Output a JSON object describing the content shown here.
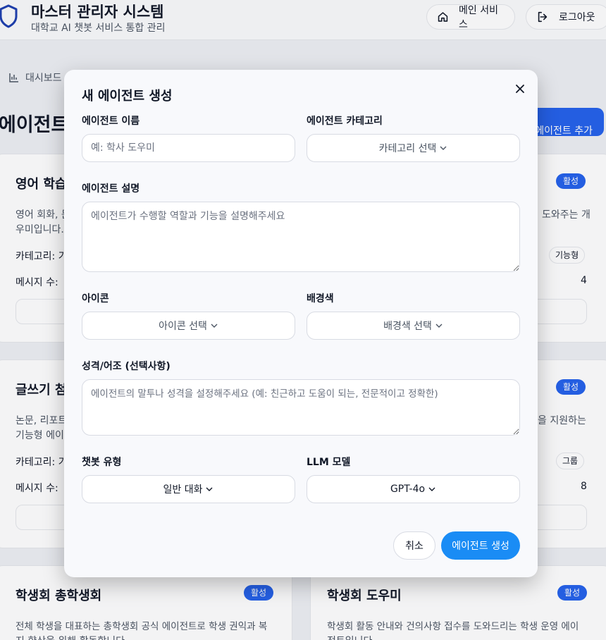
{
  "header": {
    "title": "마스터 관리자 시스템",
    "subtitle": "대학교 AI 챗봇 서비스 통합 관리",
    "home_label": "메인 서비스",
    "logout_label": "로그아웃"
  },
  "breadcrumb": {
    "label": "대시보드"
  },
  "page": {
    "title": "에이전트",
    "add_button": "에이전트 추가"
  },
  "cards": [
    {
      "title": "영어 학습",
      "badge": "활성",
      "desc1": "영어 회화, 문",
      "desc2": "우미입니다.",
      "desc_right": "도와주는 개",
      "category_label": "카테고리: 기",
      "tag": "기능형",
      "msg_label": "메시지 수:",
      "msg_count": "4"
    },
    {
      "title": "글쓰기 첨",
      "badge": "활성",
      "desc1": "논문, 리포트",
      "desc2": "기능형 에이",
      "desc_right": "을 지원하는",
      "category_label": "카테고리: 기",
      "tag": "그룹",
      "msg_label": "메시지 수:",
      "msg_count": "8"
    },
    {
      "title": "학생회 총학생회",
      "badge": "활성",
      "desc1": "전체 학생을 대표하는 총학생회 공식 에이전트로 학생 권익과 복",
      "desc2": "지 향상을 위해 활동합니다."
    },
    {
      "title": "학생회 도우미",
      "badge": "활성",
      "desc1": "학생회 활동 안내와 건의사항 접수를 도와드리는 학생 운영 에이",
      "desc2": "전트입니다."
    }
  ],
  "modal": {
    "title": "새 에이전트 생성",
    "name_label": "에이전트 이름",
    "name_placeholder": "예: 학사 도우미",
    "category_label": "에이전트 카테고리",
    "category_value": "카테고리 선택",
    "desc_label": "에이전트 설명",
    "desc_placeholder": "에이전트가 수행할 역할과 기능을 설명해주세요",
    "icon_label": "아이콘",
    "icon_value": "아이콘 선택",
    "bg_label": "배경색",
    "bg_value": "배경색 선택",
    "persona_label": "성격/어조 (선택사항)",
    "persona_placeholder": "에이전트의 말투나 성격을 설정해주세요 (예: 친근하고 도움이 되는, 전문적이고 정확한)",
    "chatbot_type_label": "챗봇 유형",
    "chatbot_type_value": "일반 대화",
    "llm_label": "LLM 모델",
    "llm_value": "GPT-4o",
    "cancel_label": "취소",
    "create_label": "에이전트 생성"
  },
  "colors": {
    "accent": "#1a8cf5",
    "badge": "#2563eb",
    "brand": "#1e40af"
  },
  "icons": [
    "shield-icon",
    "home-icon",
    "logout-icon",
    "chart-icon",
    "close-icon",
    "chevron-down-icon"
  ]
}
